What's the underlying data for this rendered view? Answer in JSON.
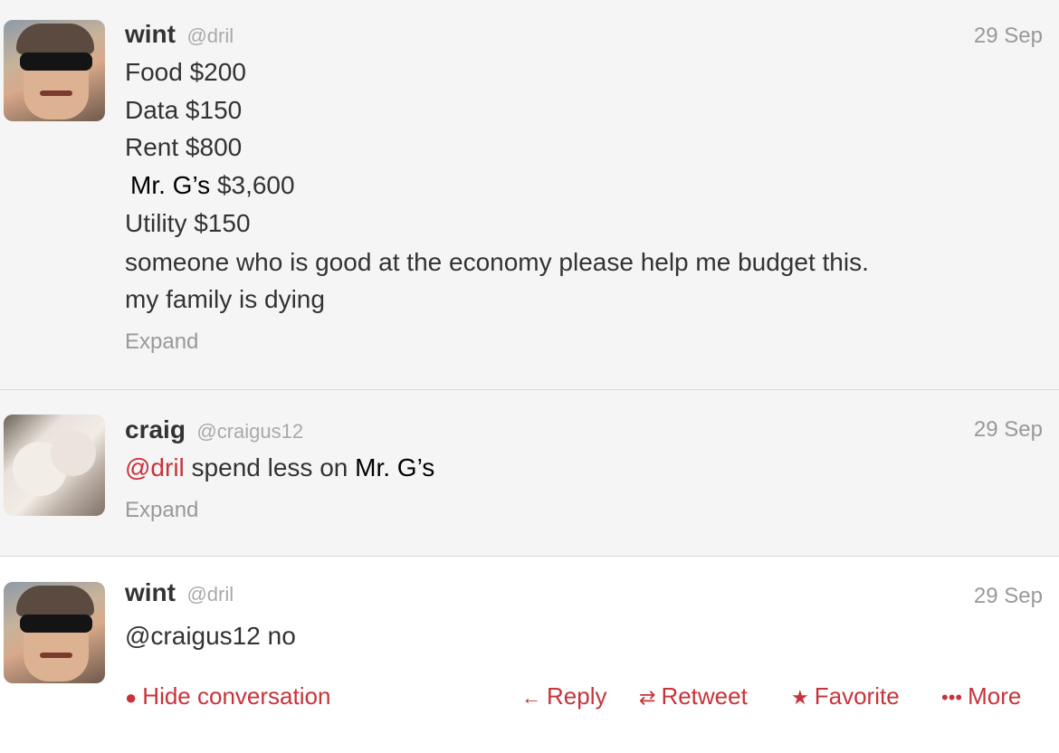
{
  "tweets": [
    {
      "name": "wint",
      "handle": "@dril",
      "date": "29 Sep",
      "lines": [
        "Food $200",
        "Data $150",
        "Rent $800",
        "Utility $150",
        "someone who is good at the economy please help me budget this.",
        "my family is dying"
      ],
      "overlay_line": {
        "overlay": "Mr. G’s",
        "rest": "$3,600"
      },
      "expand": "Expand"
    },
    {
      "name": "craig",
      "handle": "@craigus12",
      "date": "29 Sep",
      "mention": "@dril",
      "text": "spend less on",
      "overlay": "Mr. G’s",
      "expand": "Expand"
    },
    {
      "name": "wint",
      "handle": "@dril",
      "date": "29 Sep",
      "mention": "@craigus12",
      "text": "no",
      "actions": {
        "hide": "Hide conversation",
        "reply": "Reply",
        "retweet": "Retweet",
        "favorite": "Favorite",
        "more": "More"
      }
    }
  ],
  "icons": {
    "hide": "speech-bubble-icon",
    "reply": "reply-arrow-icon",
    "retweet": "retweet-icon",
    "favorite": "star-icon",
    "more": "more-dots-icon"
  },
  "colors": {
    "accent": "#c8333b",
    "muted": "#999999",
    "text": "#333333"
  }
}
